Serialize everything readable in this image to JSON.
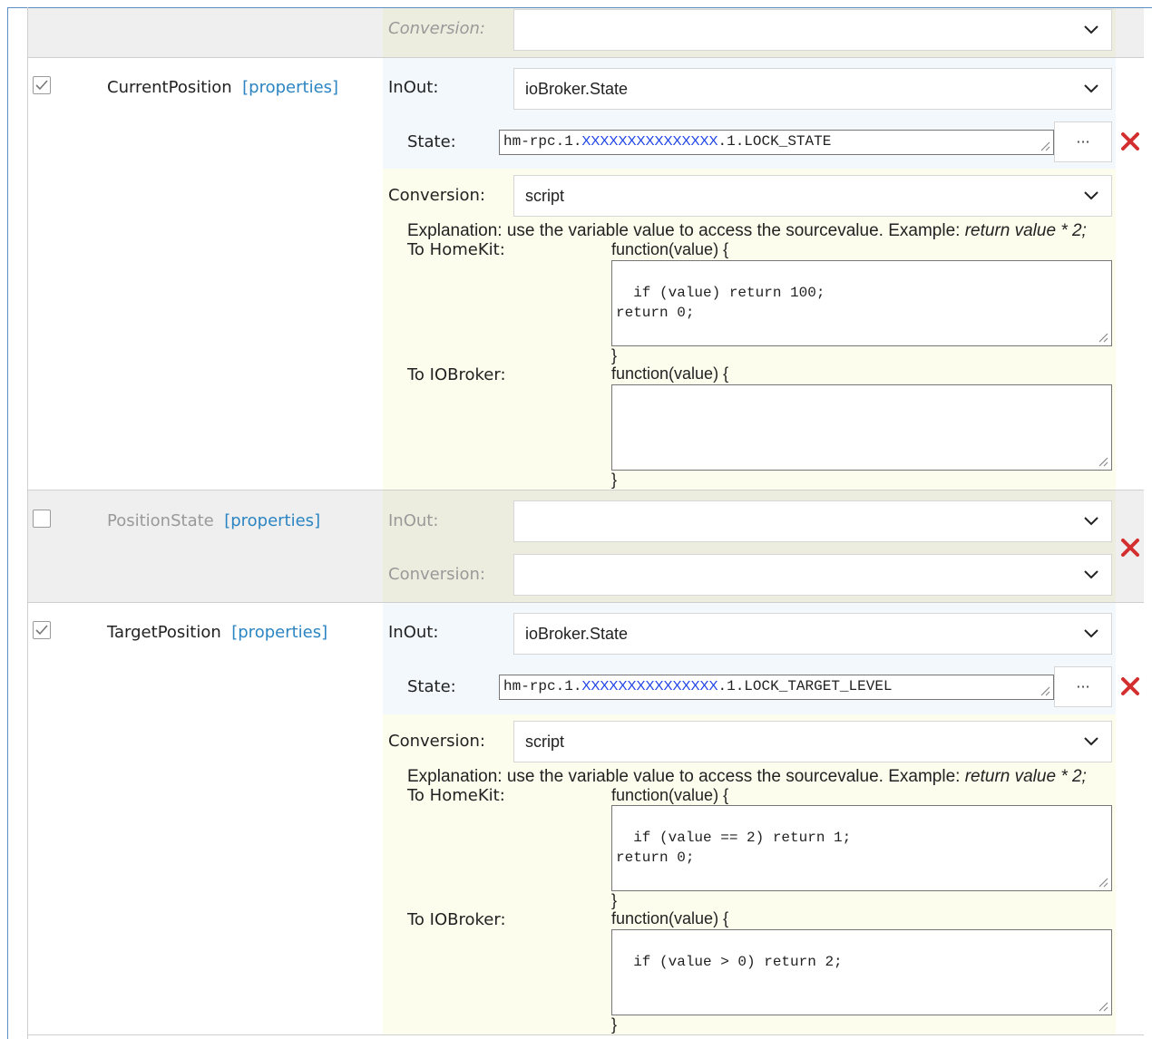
{
  "labels": {
    "conversion": "Conversion:",
    "inout": "InOut:",
    "state": "State:",
    "to_homekit": "To HomeKit:",
    "to_iobroker": "To IOBroker:",
    "func_open": "function(value) {",
    "func_close": "}",
    "properties": "[properties]",
    "dots": "···",
    "explanation_prefix": "Explanation: use the variable value to access the sourcevalue. Example: ",
    "explanation_example": "return value * 2;"
  },
  "top_row": {
    "conversion_value": ""
  },
  "characteristics": [
    {
      "name": "CurrentPosition",
      "enabled": true,
      "inout_value": "ioBroker.State",
      "state_prefix": "hm-rpc.1.",
      "state_masked": "XXXXXXXXXXXXXXX",
      "state_suffix": ".1.LOCK_STATE",
      "conversion_value": "script",
      "to_homekit_code": "if (value) return 100;\nreturn 0;",
      "to_iobroker_code": ""
    },
    {
      "name": "PositionState",
      "enabled": false,
      "inout_value": "",
      "conversion_value": ""
    },
    {
      "name": "TargetPosition",
      "enabled": true,
      "inout_value": "ioBroker.State",
      "state_prefix": "hm-rpc.1.",
      "state_masked": "XXXXXXXXXXXXXXX",
      "state_suffix": ".1.LOCK_TARGET_LEVEL",
      "conversion_value": "script",
      "to_homekit_code": "if (value == 2) return 1;\nreturn 0;",
      "to_iobroker_code": "if (value > 0) return 2;"
    }
  ],
  "colors": {
    "link": "#2b85c2",
    "delete": "#d32f2f",
    "masked": "#1a3fe6"
  }
}
